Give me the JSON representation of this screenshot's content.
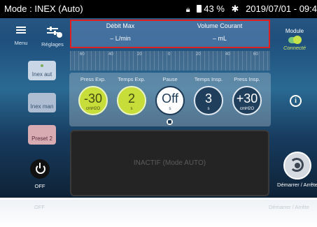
{
  "status": {
    "title": "Mode : INEX (Auto)",
    "battery": "43 %",
    "datetime": "2019/07/01 - 09:4"
  },
  "toolbar": {
    "menu_label": "Menu",
    "reglages_label": "Réglages"
  },
  "top_panel": {
    "debit_label": "Débit Max",
    "debit_value": "L/min",
    "volume_label": "Volume Courant",
    "volume_value": "mL"
  },
  "module": {
    "label": "Module",
    "status": "Connecté"
  },
  "ruler": {
    "numbers": [
      "60",
      "40",
      "20",
      "0",
      "20",
      "40",
      "60"
    ]
  },
  "sidebar": {
    "items": [
      {
        "label": "Inex aut"
      },
      {
        "label": "Inex man"
      },
      {
        "label": "Preset 2"
      }
    ]
  },
  "params": [
    {
      "label": "Press Exp.",
      "value": "-30",
      "unit": "cmH2O"
    },
    {
      "label": "Temps Exp.",
      "value": "2",
      "unit": "s"
    },
    {
      "label": "Pause",
      "value": "Off",
      "unit": "s"
    },
    {
      "label": "Temps Insp.",
      "value": "3",
      "unit": "s"
    },
    {
      "label": "Press Insp.",
      "value": "+30",
      "unit": "cmH2O"
    }
  ],
  "display": {
    "text": "INACTIF (Mode AUTO)"
  },
  "power": {
    "label": "OFF"
  },
  "start": {
    "label": "Démarrer / Arrête"
  },
  "reflection": {
    "off": "OFF",
    "start": "Démarrer / Arrête"
  },
  "colors": {
    "accent_green": "#c6dd3a",
    "border_red": "#e02020",
    "navy": "#1f3f5c"
  }
}
